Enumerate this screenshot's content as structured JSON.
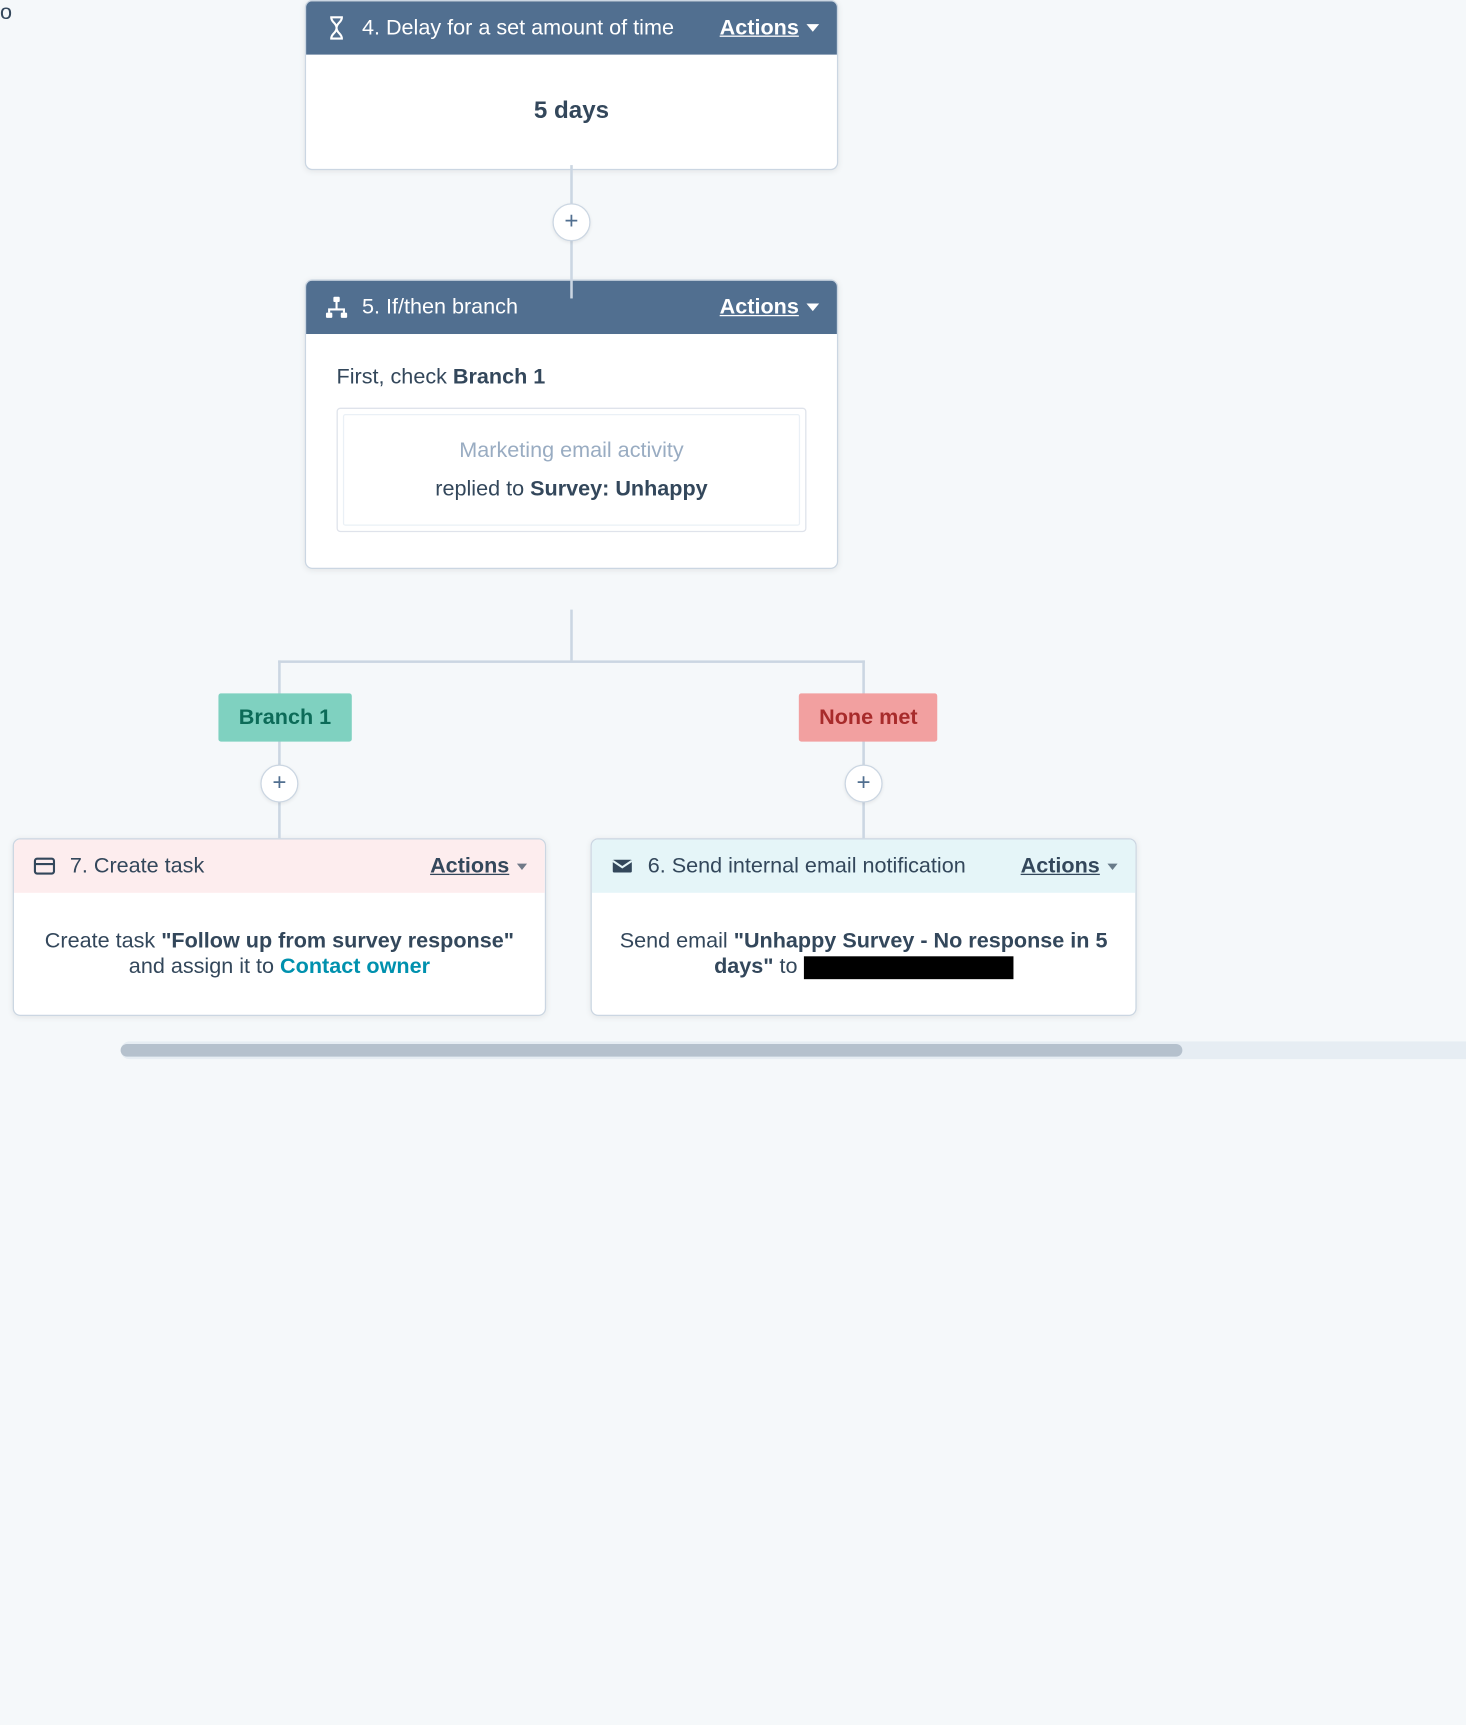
{
  "nodes": {
    "delay": {
      "title": "4. Delay for a set amount of time",
      "actions": "Actions",
      "value": "5 days"
    },
    "branch": {
      "title": "5. If/then branch",
      "actions": "Actions",
      "check_prefix": "First, check ",
      "check_bold": "Branch 1",
      "cond_muted": "Marketing email activity",
      "cond_prefix": "replied to ",
      "cond_bold": "Survey: Unhappy"
    },
    "task": {
      "title": "7. Create task",
      "actions": "Actions",
      "body_prefix": "Create task ",
      "body_bold": "\"Follow up from survey response\"",
      "body_mid": " and assign it to ",
      "body_link": "Contact owner"
    },
    "email": {
      "title": "6. Send internal email notification",
      "actions": "Actions",
      "body_prefix": "Send email ",
      "body_bold": "\"Unhappy Survey - No response in 5 days\"",
      "body_mid": " to "
    }
  },
  "badges": {
    "branch1": "Branch 1",
    "nonemet": "None met"
  },
  "glyphs": {
    "plus": "+"
  }
}
